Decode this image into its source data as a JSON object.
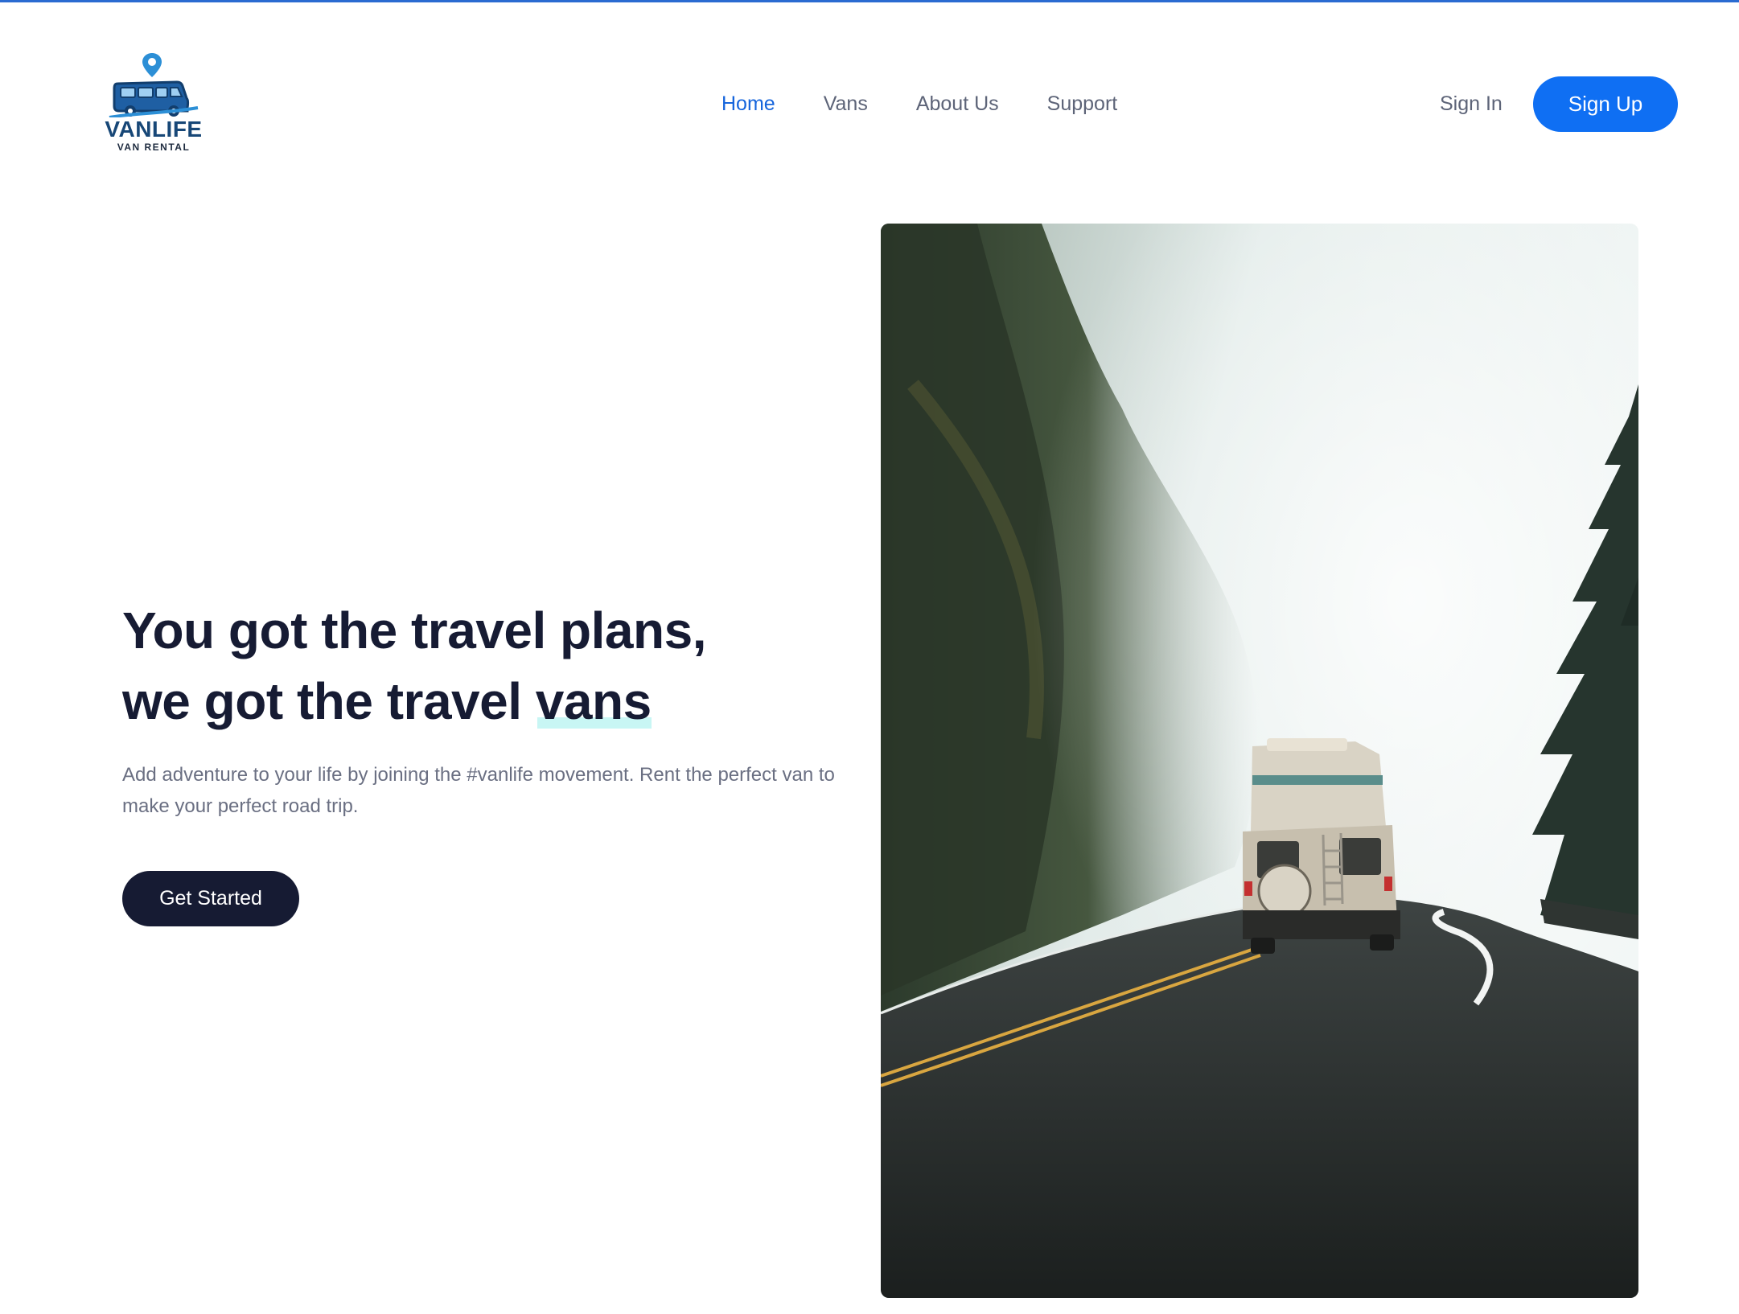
{
  "brand": {
    "name": "VANLIFE",
    "tagline": "VAN RENTAL",
    "logo_icon": "van-with-location-pin-icon",
    "color": "#174777"
  },
  "nav": {
    "items": [
      {
        "label": "Home",
        "active": true
      },
      {
        "label": "Vans",
        "active": false
      },
      {
        "label": "About Us",
        "active": false
      },
      {
        "label": "Support",
        "active": false
      }
    ]
  },
  "auth": {
    "sign_in": "Sign In",
    "sign_up": "Sign Up"
  },
  "hero": {
    "title_line1": "You got the travel plans,",
    "title_line2_prefix": "we got the travel ",
    "title_highlight": "vans",
    "subtitle": "Add adventure to your life by joining the #vanlife movement. Rent the perfect van to make your perfect road trip.",
    "cta": "Get Started",
    "image_subject": "camper-van-on-foggy-forest-road"
  },
  "colors": {
    "accent": "#0f6ff3",
    "active_nav": "#1665dc",
    "dark": "#161b33",
    "highlight": "#c8f6f4",
    "muted_text": "#6a6f82"
  }
}
